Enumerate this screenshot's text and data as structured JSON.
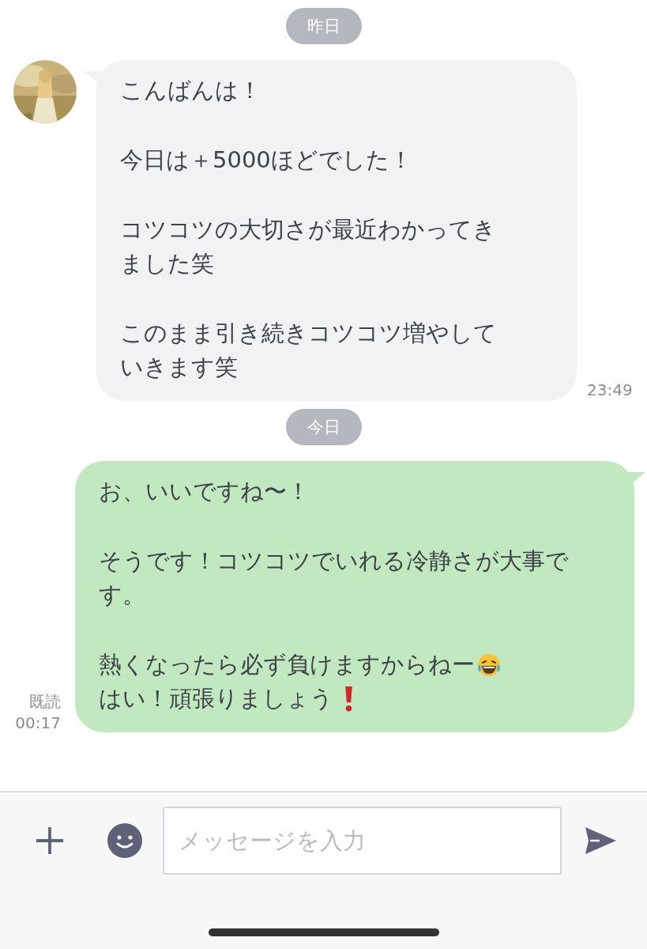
{
  "messages": [
    {
      "kind": "date",
      "label": "昨日"
    },
    {
      "kind": "received",
      "time": "23:49",
      "paragraphs": [
        {
          "lines": [
            {
              "text": "こんばんは！"
            }
          ]
        },
        {
          "lines": [
            {
              "text": "今日は＋5000ほどでした！"
            }
          ]
        },
        {
          "lines": [
            {
              "text": "コツコツの大切さが最近わかってき"
            },
            {
              "text": "ました笑"
            }
          ]
        },
        {
          "lines": [
            {
              "text": "このまま引き続きコツコツ増やして"
            },
            {
              "text": "いきます笑"
            }
          ]
        }
      ]
    },
    {
      "kind": "date",
      "label": "今日"
    },
    {
      "kind": "sent",
      "read": "既読",
      "time": "00:17",
      "paragraphs": [
        {
          "lines": [
            {
              "text": "お、いいですね〜！"
            }
          ]
        },
        {
          "lines": [
            {
              "text": "そうです！コツコツでいれる冷静さが大事で"
            },
            {
              "text": "す。"
            }
          ]
        },
        {
          "lines": [
            {
              "text": "熱くなったら必ず負けますからねー",
              "trailing": {
                "kind": "laughing"
              }
            },
            {
              "text": "はい！頑張りましょう",
              "trailing": {
                "kind": "exclamation"
              }
            }
          ]
        }
      ]
    }
  ],
  "composer": {
    "placeholder": "メッセージを入力"
  }
}
